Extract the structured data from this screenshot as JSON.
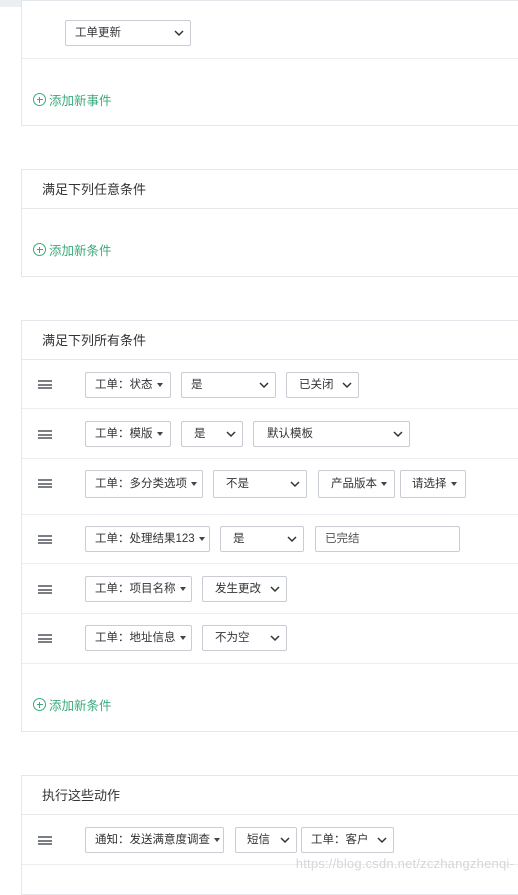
{
  "events_card": {
    "event_select_value": "工单更新",
    "add_event_label": "添加新事件"
  },
  "any_card": {
    "title": "满足下列任意条件",
    "add_condition_label": "添加新条件"
  },
  "all_card": {
    "title": "满足下列所有条件",
    "rows": [
      {
        "field": "工单：状态",
        "operator": "是",
        "value": "已关闭"
      },
      {
        "field": "工单：模版",
        "operator": "是",
        "value": "默认模板"
      },
      {
        "field": "工单：多分类选项",
        "operator": "不是",
        "value": "产品版本",
        "value2": "请选择"
      },
      {
        "field": "工单：处理结果123",
        "operator": "是",
        "value": "已完结"
      },
      {
        "field": "工单：项目名称",
        "operator": "发生更改"
      },
      {
        "field": "工单：地址信息",
        "operator": "不为空"
      }
    ],
    "add_condition_label": "添加新条件"
  },
  "actions_card": {
    "title": "执行这些动作",
    "rows": [
      {
        "action": "通知：发送满意度调查",
        "channel": "短信",
        "target": "工单：客户"
      }
    ]
  },
  "watermark": "https://blog.csdn.net/zczhangzhenqi-",
  "colors": {
    "accent_green": "#3aaa7c",
    "border": "#c9cdd3"
  }
}
